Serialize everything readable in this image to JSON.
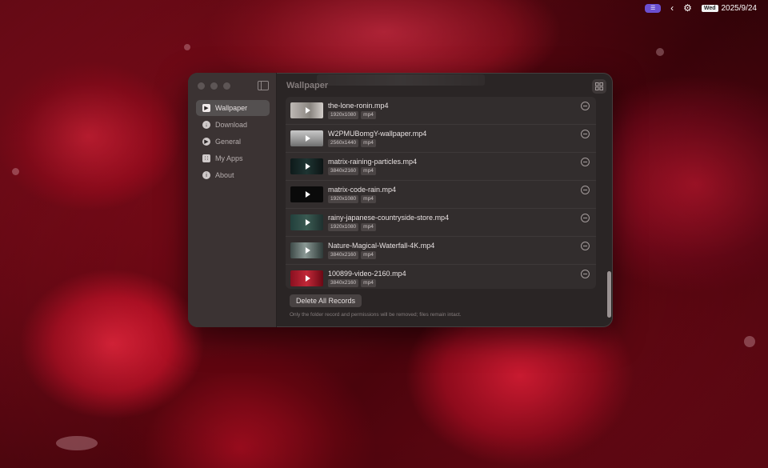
{
  "menubar": {
    "day": "Wed",
    "date": "2025/9/24"
  },
  "window": {
    "title": "Wallpaper",
    "sidebar": {
      "items": [
        {
          "label": "Wallpaper",
          "active": true
        },
        {
          "label": "Download",
          "active": false
        },
        {
          "label": "General",
          "active": false
        },
        {
          "label": "My Apps",
          "active": false
        },
        {
          "label": "About",
          "active": false
        }
      ]
    },
    "records": [
      {
        "name": "the-lone-ronin.mp4",
        "resolution": "1920x1080",
        "format": "mp4"
      },
      {
        "name": "W2PMUBomgY-wallpaper.mp4",
        "resolution": "2560x1440",
        "format": "mp4"
      },
      {
        "name": "matrix-raining-particles.mp4",
        "resolution": "3840x2160",
        "format": "mp4"
      },
      {
        "name": "matrix-code-rain.mp4",
        "resolution": "1920x1080",
        "format": "mp4"
      },
      {
        "name": "rainy-japanese-countryside-store.mp4",
        "resolution": "1920x1080",
        "format": "mp4"
      },
      {
        "name": "Nature-Magical-Waterfall-4K.mp4",
        "resolution": "3840x2160",
        "format": "mp4"
      },
      {
        "name": "100899-video-2160.mp4",
        "resolution": "3840x2160",
        "format": "mp4"
      }
    ],
    "delete_all_label": "Delete All Records",
    "note": "Only the folder record and permissions will be removed; files remain intact."
  },
  "colors": {
    "accent_pill": "#6b4fd0",
    "window_bg": "#2a2525",
    "sidebar_bg": "#3b3333"
  }
}
